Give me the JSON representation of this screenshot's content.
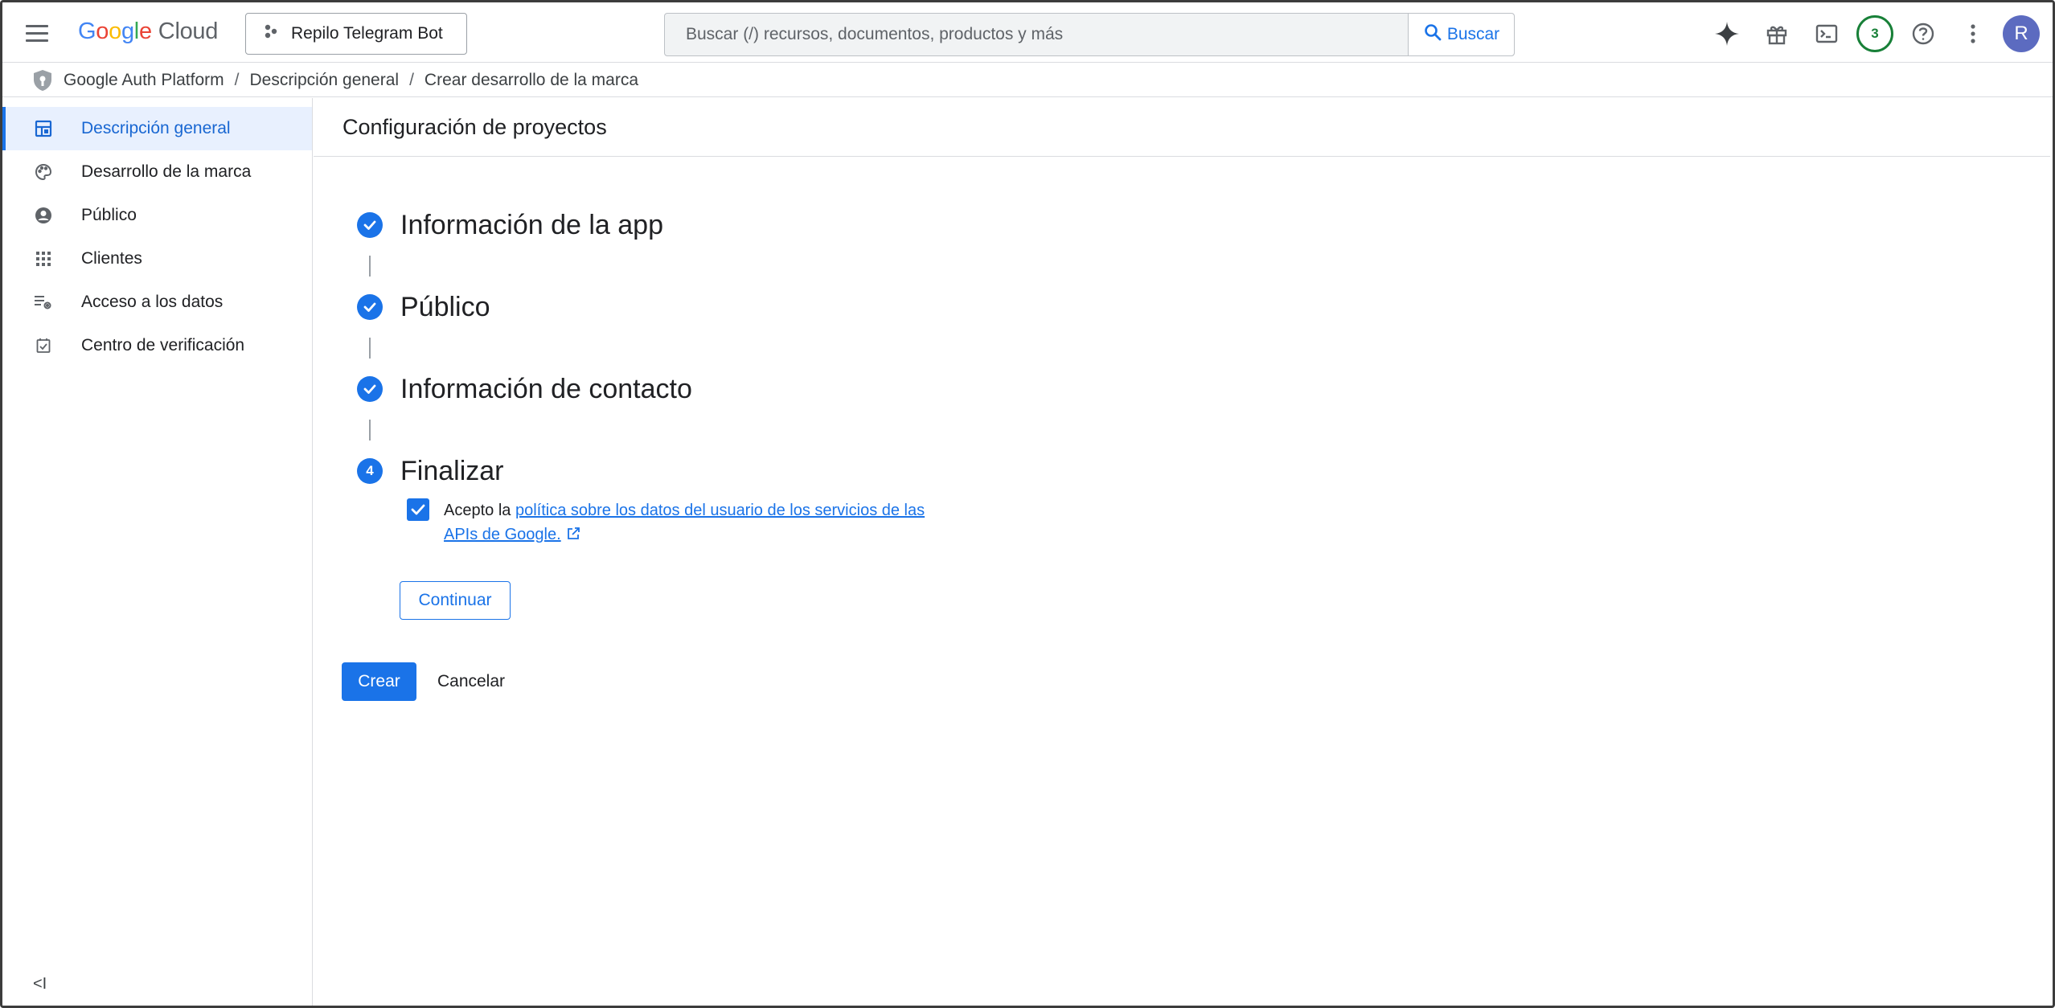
{
  "header": {
    "logo_word": "Google",
    "logo_product": "Cloud",
    "project_name": "Repilo Telegram Bot",
    "search_placeholder": "Buscar (/) recursos, documentos, productos y más",
    "search_button": "Buscar",
    "notification_count": "3",
    "avatar_initial": "R",
    "accent_color": "#1a73e8"
  },
  "breadcrumb": {
    "items": [
      "Google Auth Platform",
      "Descripción general",
      "Crear desarrollo de la marca"
    ],
    "separator": "/"
  },
  "sidebar": {
    "items": [
      {
        "label": "Descripción general",
        "icon": "dashboard-icon",
        "active": true
      },
      {
        "label": "Desarrollo de la marca",
        "icon": "palette-icon",
        "active": false
      },
      {
        "label": "Público",
        "icon": "person-circle-icon",
        "active": false
      },
      {
        "label": "Clientes",
        "icon": "grid-dots-icon",
        "active": false
      },
      {
        "label": "Acceso a los datos",
        "icon": "list-settings-icon",
        "active": false
      },
      {
        "label": "Centro de verificación",
        "icon": "checkbox-icon",
        "active": false
      }
    ],
    "collapse_label": "<I"
  },
  "main": {
    "page_title": "Configuración de proyectos",
    "steps": [
      {
        "title": "Información de la app",
        "status": "complete"
      },
      {
        "title": "Público",
        "status": "complete"
      },
      {
        "title": "Información de contacto",
        "status": "complete"
      },
      {
        "title": "Finalizar",
        "status": "current",
        "number": "4"
      }
    ],
    "agreement": {
      "checked": true,
      "prefix": "Acepto la ",
      "link_text_line1": "política sobre los datos del usuario de los servicios de las",
      "link_text_line2": "APIs de Google."
    },
    "continue_button": "Continuar",
    "create_button": "Crear",
    "cancel_button": "Cancelar"
  }
}
